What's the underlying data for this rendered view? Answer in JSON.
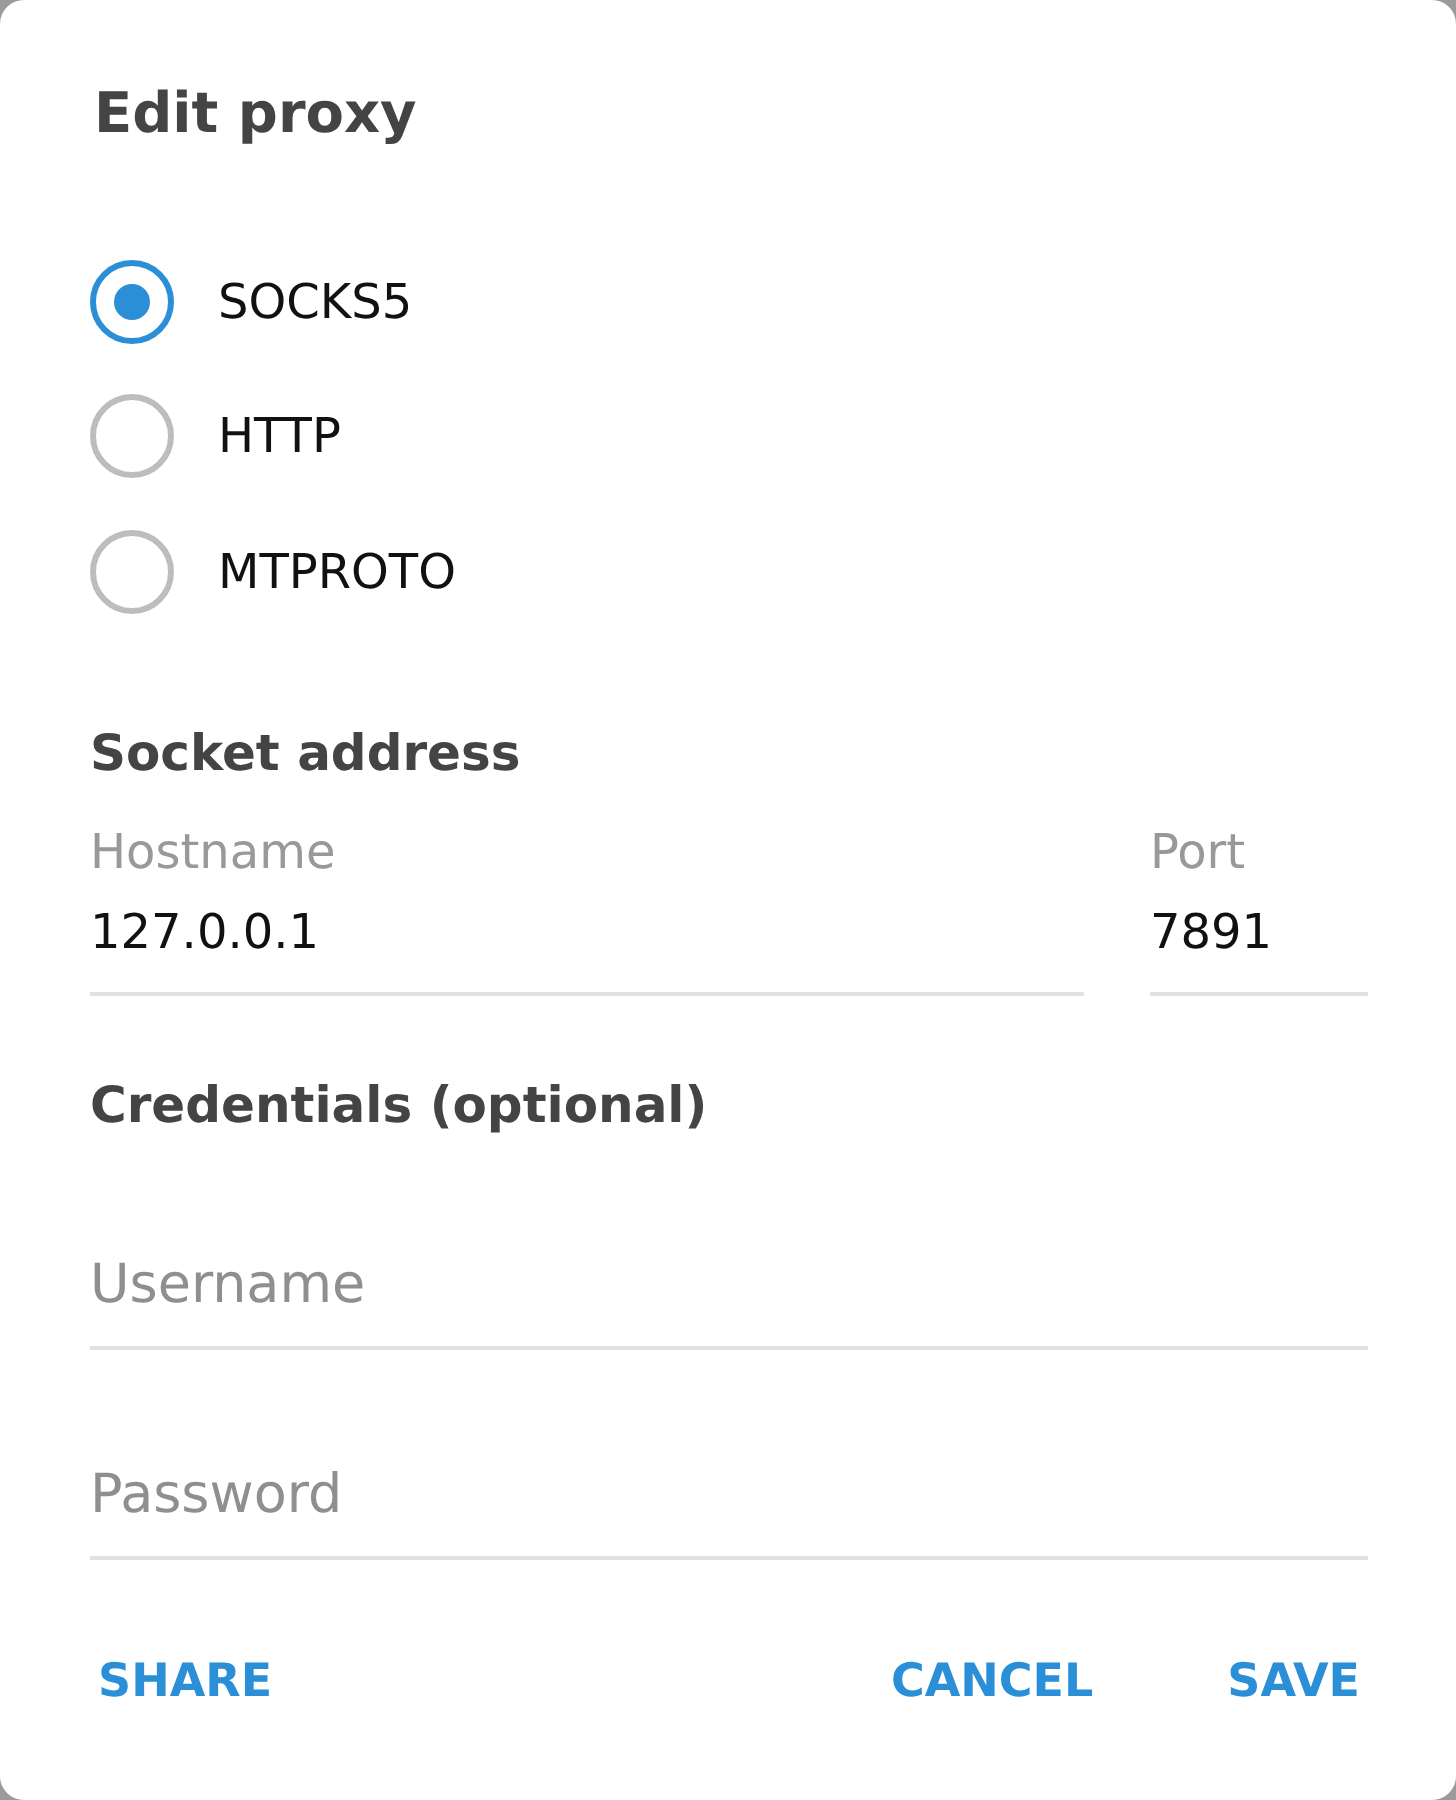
{
  "dialog": {
    "title": "Edit proxy"
  },
  "proxy_types": [
    {
      "label": "SOCKS5",
      "selected": true
    },
    {
      "label": "HTTP",
      "selected": false
    },
    {
      "label": "MTPROTO",
      "selected": false
    }
  ],
  "socket_address": {
    "heading": "Socket address",
    "fields": [
      {
        "label": "Hostname",
        "value": "127.0.0.1"
      },
      {
        "label": "Port",
        "value": "7891"
      }
    ]
  },
  "credentials": {
    "heading": "Credentials (optional)",
    "fields": [
      {
        "placeholder": "Username"
      },
      {
        "placeholder": "Password"
      }
    ]
  },
  "buttons": {
    "left": [
      {
        "label": "SHARE"
      }
    ],
    "right": [
      {
        "label": "CANCEL"
      },
      {
        "label": "SAVE"
      }
    ]
  }
}
